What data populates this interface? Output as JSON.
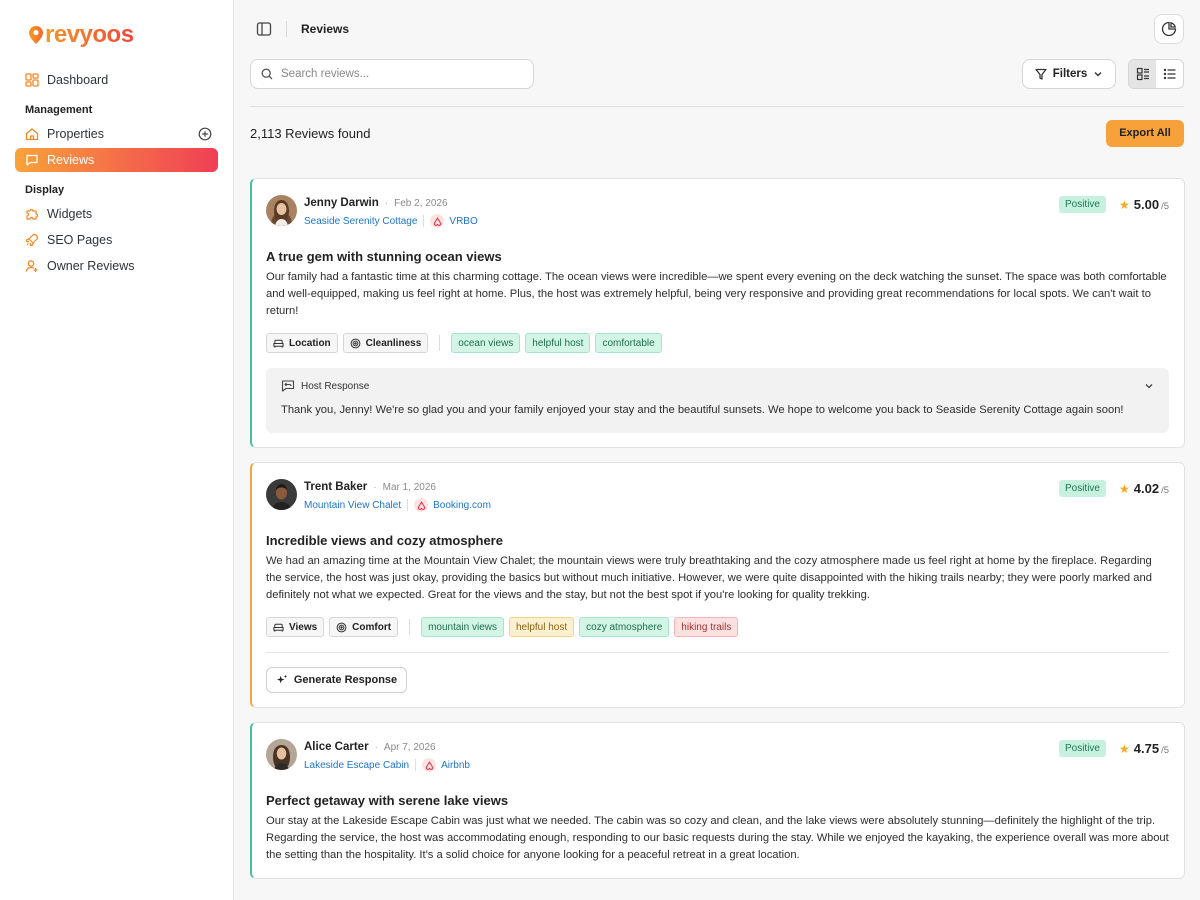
{
  "app": {
    "logo_text": "revyoos"
  },
  "sidebar": {
    "dashboard": "Dashboard",
    "management_label": "Management",
    "properties": "Properties",
    "reviews": "Reviews",
    "display_label": "Display",
    "widgets": "Widgets",
    "seo_pages": "SEO Pages",
    "owner_reviews": "Owner Reviews"
  },
  "topbar": {
    "title": "Reviews"
  },
  "search": {
    "placeholder": "Search reviews..."
  },
  "toolbar": {
    "filters_label": "Filters"
  },
  "results": {
    "count_text": "2,113 Reviews found",
    "export_label": "Export All"
  },
  "reviews": [
    {
      "name": "Jenny Darwin",
      "date": "Feb 2, 2026",
      "property": "Seaside Serenity Cottage",
      "platform": "VRBO",
      "sentiment": "Positive",
      "rating": "5.00",
      "rating_max": "/5",
      "title": "A true gem with stunning ocean views",
      "body": "Our family had a fantastic time at this charming cottage. The ocean views were incredible—we spent every evening on the deck watching the sunset. The space was both comfortable and well-equipped, making us feel right at home. Plus, the host was extremely helpful, being very responsive and providing great recommendations for local spots. We can't wait to return!",
      "categories": [
        "Location",
        "Cleanliness"
      ],
      "keywords": [
        "ocean views",
        "helpful host",
        "comfortable"
      ],
      "host_response_label": "Host Response",
      "host_response": "Thank you, Jenny! We're so glad you and your family enjoyed your stay and the beautiful sunsets. We hope to welcome you back to Seaside Serenity Cottage again soon!"
    },
    {
      "name": "Trent Baker",
      "date": "Mar 1, 2026",
      "property": "Mountain View Chalet",
      "platform": "Booking.com",
      "sentiment": "Positive",
      "rating": "4.02",
      "rating_max": "/5",
      "title": "Incredible views and cozy atmosphere",
      "body": "We had an amazing time at the Mountain View Chalet; the mountain views were truly breathtaking and the cozy atmosphere made us feel right at home by the fireplace. Regarding the service, the host was just okay, providing the basics but without much initiative. However, we were quite disappointed with the hiking trails nearby; they were poorly marked and definitely not what we expected. Great for the views and the stay, but not the best spot if you're looking for quality trekking.",
      "categories": [
        "Views",
        "Comfort"
      ],
      "keywords": [
        "mountain views",
        "helpful host",
        "cozy atmosphere",
        "hiking trails"
      ],
      "generate_label": "Generate Response"
    },
    {
      "name": "Alice Carter",
      "date": "Apr 7, 2026",
      "property": "Lakeside Escape Cabin",
      "platform": "Airbnb",
      "sentiment": "Positive",
      "rating": "4.75",
      "rating_max": "/5",
      "title": "Perfect getaway with serene lake views",
      "body": "Our stay at the Lakeside Escape Cabin was just what we needed. The cabin was so cozy and clean, and the lake views were absolutely stunning—definitely the highlight of the trip. Regarding the service, the host was accommodating enough, responding to our basic requests during the stay. While we enjoyed the kayaking, the experience overall was more about the setting than the hospitality. It's a solid choice for anyone looking for a peaceful retreat in a great location."
    }
  ]
}
